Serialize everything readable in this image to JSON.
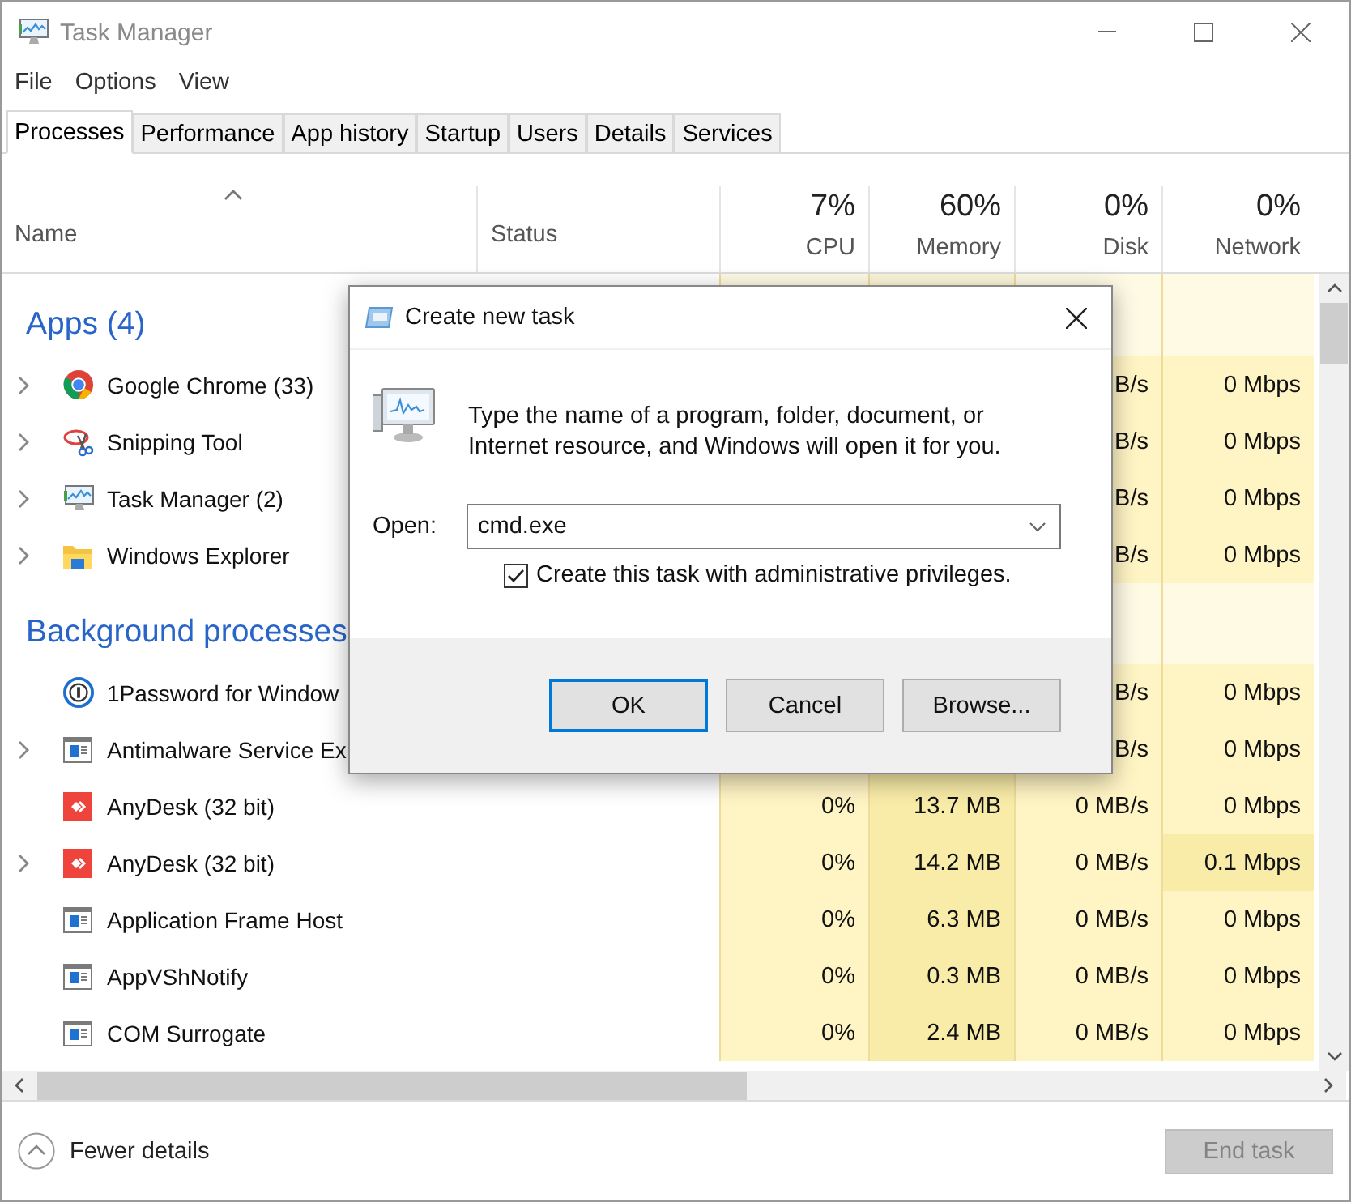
{
  "window": {
    "title": "Task Manager"
  },
  "menu": [
    "File",
    "Options",
    "View"
  ],
  "tabs": [
    {
      "label": "Processes",
      "selected": true
    },
    {
      "label": "Performance",
      "selected": false
    },
    {
      "label": "App history",
      "selected": false
    },
    {
      "label": "Startup",
      "selected": false
    },
    {
      "label": "Users",
      "selected": false
    },
    {
      "label": "Details",
      "selected": false
    },
    {
      "label": "Services",
      "selected": false
    }
  ],
  "columns": [
    {
      "label": "Name",
      "sorted": true
    },
    {
      "label": "Status",
      "sorted": false
    },
    {
      "label": "CPU",
      "total": "7%",
      "color": "#fff4c4",
      "sorted": false
    },
    {
      "label": "Memory",
      "total": "60%",
      "color": "#f9eca8",
      "sorted": false
    },
    {
      "label": "Disk",
      "total": "0%",
      "color": "#fff4c4",
      "sorted": false
    },
    {
      "label": "Network",
      "total": "0%",
      "color": "#fff4c4",
      "sorted": false
    }
  ],
  "groups": [
    {
      "title": "Apps (4)",
      "rows": [
        {
          "name": "Google Chrome (33)",
          "expandable": true,
          "disk": "B/s",
          "network": "0 Mbps",
          "network_busy": false
        },
        {
          "name": "Snipping Tool",
          "expandable": true,
          "disk": "B/s",
          "network": "0 Mbps",
          "network_busy": false
        },
        {
          "name": "Task Manager (2)",
          "expandable": true,
          "disk": "B/s",
          "network": "0 Mbps",
          "network_busy": false
        },
        {
          "name": "Windows Explorer",
          "expandable": true,
          "disk": "B/s",
          "network": "0 Mbps",
          "network_busy": false
        }
      ]
    },
    {
      "title": "Background processes",
      "rows": [
        {
          "name": "1Password for Window",
          "expandable": false,
          "disk": "B/s",
          "network": "0 Mbps",
          "network_busy": false
        },
        {
          "name": "Antimalware Service Ex",
          "expandable": true,
          "disk": "B/s",
          "network": "0 Mbps",
          "network_busy": false
        },
        {
          "name": "AnyDesk (32 bit)",
          "expandable": false,
          "cpu": "0%",
          "memory": "13.7 MB",
          "disk": "0 MB/s",
          "network": "0 Mbps",
          "network_busy": false
        },
        {
          "name": "AnyDesk (32 bit)",
          "expandable": true,
          "cpu": "0%",
          "memory": "14.2 MB",
          "disk": "0 MB/s",
          "network": "0.1 Mbps",
          "network_busy": true
        },
        {
          "name": "Application Frame Host",
          "expandable": false,
          "cpu": "0%",
          "memory": "6.3 MB",
          "disk": "0 MB/s",
          "network": "0 Mbps",
          "network_busy": false
        },
        {
          "name": "AppVShNotify",
          "expandable": false,
          "cpu": "0%",
          "memory": "0.3 MB",
          "disk": "0 MB/s",
          "network": "0 Mbps",
          "network_busy": false
        },
        {
          "name": "COM Surrogate",
          "expandable": false,
          "cpu": "0%",
          "memory": "2.4 MB",
          "disk": "0 MB/s",
          "network": "0 Mbps",
          "network_busy": false
        }
      ]
    }
  ],
  "footer": {
    "toggle": "Fewer details",
    "end_task": {
      "label": "End task",
      "disabled": true
    }
  },
  "dialog": {
    "title": "Create new task",
    "message": "Type the name of a program, folder, document, or Internet resource, and Windows will open it for you.",
    "open_label": "Open:",
    "open_value": "cmd.exe",
    "admin": {
      "label": "Create this task with administrative privileges.",
      "checked": true
    },
    "buttons": [
      {
        "label": "OK",
        "selected": true
      },
      {
        "label": "Cancel",
        "selected": false
      },
      {
        "label": "Browse...",
        "selected": false
      }
    ]
  }
}
